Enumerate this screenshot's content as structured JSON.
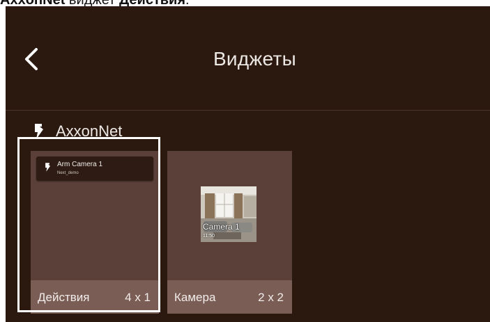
{
  "caption": {
    "bold_app": "AxxonNet",
    "middle_text": " виджет ",
    "bold_widget": "Действия",
    "end": "."
  },
  "header": {
    "back_icon": "chevron-left-icon",
    "title": "Виджеты"
  },
  "section": {
    "icon": "lightning-bolt-icon",
    "label": "AxxonNet"
  },
  "widgets": [
    {
      "name": "Действия",
      "size": "4 x 1",
      "selected": true,
      "preview": {
        "icon": "lightning-bolt-icon",
        "title": "Arm Camera 1",
        "subtitle": "Next_demo"
      }
    },
    {
      "name": "Камера",
      "size": "2 x 2",
      "selected": false,
      "preview": {
        "camera_name": "Camera 1",
        "time": "11:50"
      }
    }
  ],
  "colors": {
    "background": "#2b1910",
    "tile": "#5a4039",
    "tile_footer": "#7a5e56",
    "selection_border": "#ffffff"
  }
}
